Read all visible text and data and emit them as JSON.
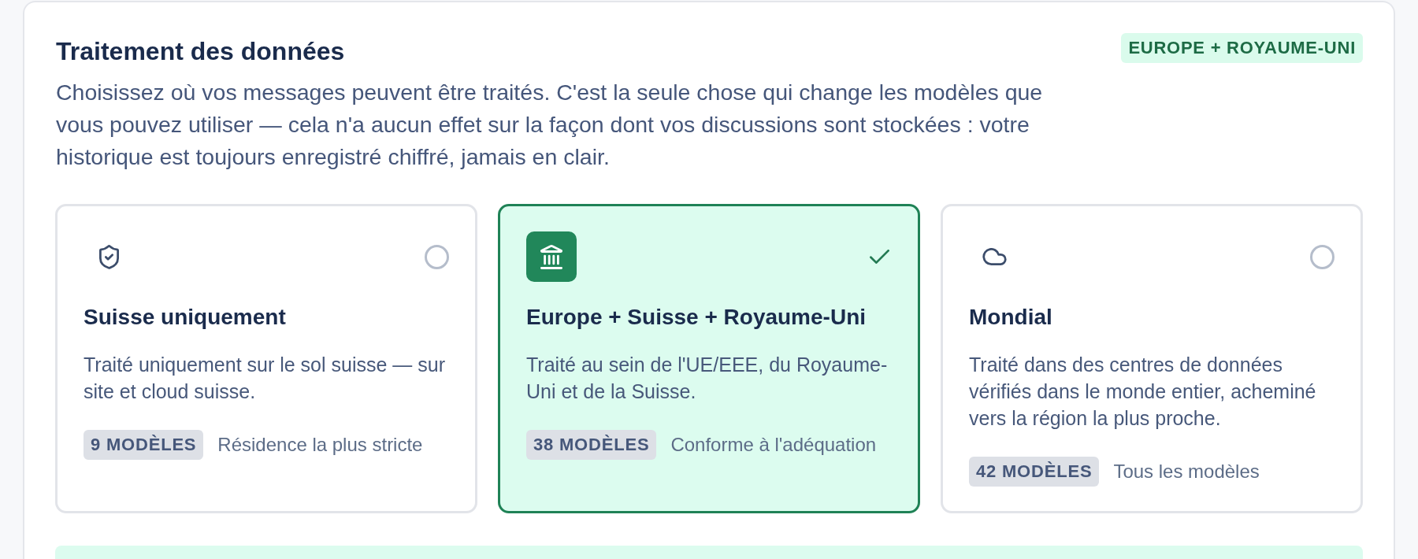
{
  "section": {
    "title": "Traitement des données",
    "badge": "EUROPE + ROYAUME-UNI",
    "description": "Choisissez où vos messages peuvent être traités. C'est la seule chose qui change les modèles que vous pouvez utiliser — cela n'a aucun effet sur la façon dont vos discussions sont stockées : votre historique est toujours enregistré chiffré, jamais en clair."
  },
  "options": [
    {
      "kind": "national",
      "title": "Suisse uniquement",
      "description": "Traité uniquement sur le sol suisse — sur site et cloud suisse.",
      "models": "9 MODÈLES",
      "note": "Résidence la plus stricte",
      "selected": false
    },
    {
      "kind": "regional",
      "title": "Europe + Suisse + Royaume-Uni",
      "description": "Traité au sein de l'UE/EEE, du Royaume-Uni et de la Suisse.",
      "models": "38 MODÈLES",
      "note": "Conforme à l'adéquation",
      "selected": true
    },
    {
      "kind": "global",
      "title": "Mondial",
      "description": "Traité dans des centres de données vérifiés dans le monde entier, acheminé vers la région la plus proche.",
      "models": "42 MODÈLES",
      "note": "Tous les modèles",
      "selected": false
    }
  ]
}
